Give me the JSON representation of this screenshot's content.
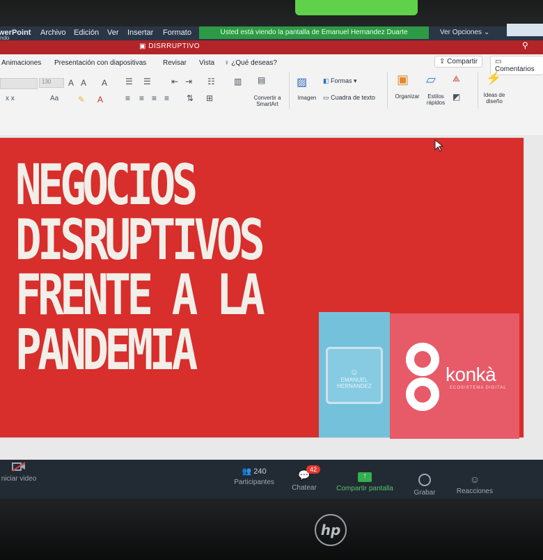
{
  "zoom": {
    "top_menu": [
      "werPoint",
      "Archivo",
      "Edición",
      "Ver",
      "Insertar",
      "Formato"
    ],
    "share_banner": "Usted está viendo la pantalla de Emanuel Hernandez Duarte",
    "view_options": "Ver Opciones ⌄",
    "left_stub": "ndo",
    "toolbar": {
      "video_label": "niciar video",
      "participants_count": "240",
      "participants_label": "Participantes",
      "chat_label": "Chatear",
      "chat_badge": "42",
      "share_label": "Compartir pantalla",
      "record_label": "Grabar",
      "reactions_label": "Reacciones"
    }
  },
  "ppt": {
    "doc_title": "DISRRUPTIVO",
    "tabs": [
      "Animaciones",
      "Presentación con diapositivas",
      "Revisar",
      "Vista",
      "¿Qué deseas?"
    ],
    "share_button": "Compartir",
    "comments_button": "Comentarios",
    "font_size": "130",
    "ribbon": {
      "convert_smartart": "Convertir a SmartArt",
      "image": "Imagen",
      "shapes": "Formas",
      "textbox": "Cuadra de texto",
      "organize": "Organizar",
      "quick_styles": "Estilos rápidos",
      "design_ideas": "Ideas de diseño"
    },
    "slide": {
      "headline_lines": [
        "NEGOCIOS",
        "DISRUPTIVOS",
        "FRENTE A LA",
        "PANDEMIA"
      ],
      "profile_name": "EMANUEL HERNANDEZ",
      "brand": "konkà",
      "brand_tagline": "ECOSISTEMA DIGITAL",
      "colors": {
        "slide_red": "#d82e2c",
        "panel_cyan": "#74c1dc",
        "panel_pink": "#e75a68"
      }
    }
  },
  "device": {
    "logo": "hp"
  }
}
